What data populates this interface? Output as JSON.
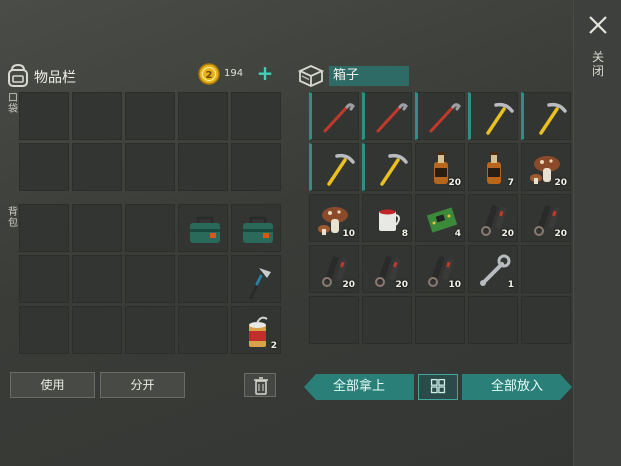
{
  "close": {
    "icon": "close-x-icon",
    "label": "关闭"
  },
  "inventory": {
    "title": "物品栏",
    "coins": "194",
    "plus": "+",
    "pocket_label": "口袋",
    "backpack_label": "背包",
    "pocket_slots": [
      {
        "item": "",
        "qty": ""
      },
      {
        "item": "",
        "qty": ""
      },
      {
        "item": "",
        "qty": ""
      },
      {
        "item": "",
        "qty": ""
      },
      {
        "item": "",
        "qty": ""
      },
      {
        "item": "",
        "qty": ""
      },
      {
        "item": "",
        "qty": ""
      },
      {
        "item": "",
        "qty": ""
      },
      {
        "item": "",
        "qty": ""
      },
      {
        "item": "",
        "qty": ""
      }
    ],
    "backpack_slots": [
      {
        "item": "",
        "qty": ""
      },
      {
        "item": "",
        "qty": ""
      },
      {
        "item": "",
        "qty": ""
      },
      {
        "item": "toolbox",
        "qty": ""
      },
      {
        "item": "toolbox",
        "qty": ""
      },
      {
        "item": "",
        "qty": ""
      },
      {
        "item": "",
        "qty": ""
      },
      {
        "item": "",
        "qty": ""
      },
      {
        "item": "",
        "qty": ""
      },
      {
        "item": "hatchet",
        "qty": ""
      },
      {
        "item": "",
        "qty": ""
      },
      {
        "item": "",
        "qty": ""
      },
      {
        "item": "",
        "qty": ""
      },
      {
        "item": "",
        "qty": ""
      },
      {
        "item": "canned-food",
        "qty": "2"
      }
    ],
    "use_label": "使用",
    "split_label": "分开"
  },
  "box": {
    "title": "箱子",
    "slots": [
      {
        "item": "crowbar",
        "qty": ""
      },
      {
        "item": "crowbar",
        "qty": ""
      },
      {
        "item": "crowbar",
        "qty": ""
      },
      {
        "item": "pickaxe",
        "qty": ""
      },
      {
        "item": "pickaxe",
        "qty": ""
      },
      {
        "item": "pickaxe",
        "qty": ""
      },
      {
        "item": "pickaxe",
        "qty": ""
      },
      {
        "item": "whiskey",
        "qty": "20"
      },
      {
        "item": "whiskey",
        "qty": "7"
      },
      {
        "item": "mushroom",
        "qty": "20"
      },
      {
        "item": "mushroom",
        "qty": "10"
      },
      {
        "item": "cup-drink",
        "qty": "8"
      },
      {
        "item": "circuit-board",
        "qty": "4"
      },
      {
        "item": "gun-parts",
        "qty": "20"
      },
      {
        "item": "gun-parts",
        "qty": "20"
      },
      {
        "item": "gun-parts",
        "qty": "20"
      },
      {
        "item": "gun-parts",
        "qty": "20"
      },
      {
        "item": "gun-parts",
        "qty": "10"
      },
      {
        "item": "wrench",
        "qty": "1"
      },
      {
        "item": "",
        "qty": ""
      },
      {
        "item": "",
        "qty": ""
      },
      {
        "item": "",
        "qty": ""
      },
      {
        "item": "",
        "qty": ""
      },
      {
        "item": "",
        "qty": ""
      },
      {
        "item": "",
        "qty": ""
      }
    ],
    "take_all_label": "全部拿上",
    "put_all_label": "全部放入",
    "sort_icon": "sort-grid-icon"
  },
  "colors": {
    "accent": "#2a7f78",
    "slot": "#333532",
    "teal_text": "#3fd0b8"
  }
}
